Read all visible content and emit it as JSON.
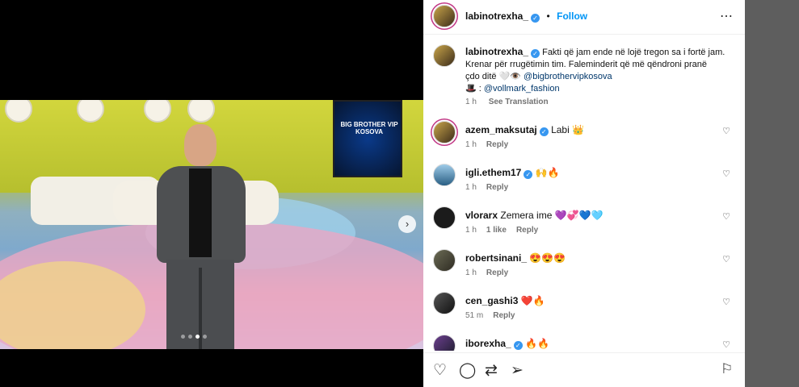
{
  "post": {
    "username": "labinotrexha_",
    "follow_label": "Follow",
    "separator": "•",
    "more_icon": "more-horizontal-icon",
    "caption_line1": "Fakti që jam ende në lojë tregon sa i fortë jam.",
    "caption_line2": "Krenar për rrugëtimin tim. Faleminderit që më qëndroni pranë",
    "caption_line3_text": "çdo ditë 🤍👁️",
    "caption_mention1": "@bigbrothervipkosova",
    "caption_line4_prefix": "🎩 :",
    "caption_mention2": "@vollmark_fashion",
    "caption_time": "1 h",
    "see_translation": "See Translation",
    "photo_screen_text": "BIG BROTHER VIP KOSOVA",
    "carousel_total": 4,
    "carousel_active": 3
  },
  "comments": [
    {
      "username": "azem_maksutaj",
      "verified": true,
      "text": "Labi 👑",
      "time": "1 h",
      "likes": "",
      "reply": "Reply"
    },
    {
      "username": "igli.ethem17",
      "verified": true,
      "text": "🙌🔥",
      "time": "1 h",
      "likes": "",
      "reply": "Reply"
    },
    {
      "username": "vlorarx",
      "verified": false,
      "text": "Zemera ime 💜💞💙🩵",
      "time": "1 h",
      "likes": "1 like",
      "reply": "Reply"
    },
    {
      "username": "robertsinani_",
      "verified": false,
      "text": "😍😍😍",
      "time": "1 h",
      "likes": "",
      "reply": "Reply"
    },
    {
      "username": "cen_gashi3",
      "verified": false,
      "text": "❤️🔥",
      "time": "51 m",
      "likes": "",
      "reply": "Reply"
    },
    {
      "username": "iborexha_",
      "verified": true,
      "text": "🔥🔥",
      "time": "",
      "likes": "",
      "reply": ""
    }
  ],
  "actions": {
    "like_icon": "heart-icon",
    "comment_icon": "comment-icon",
    "share_icon": "repost-icon",
    "send_icon": "send-icon",
    "save_icon": "bookmark-icon"
  },
  "colors": {
    "accent": "#0095f6",
    "verified": "#3797f0",
    "muted": "#737373"
  }
}
